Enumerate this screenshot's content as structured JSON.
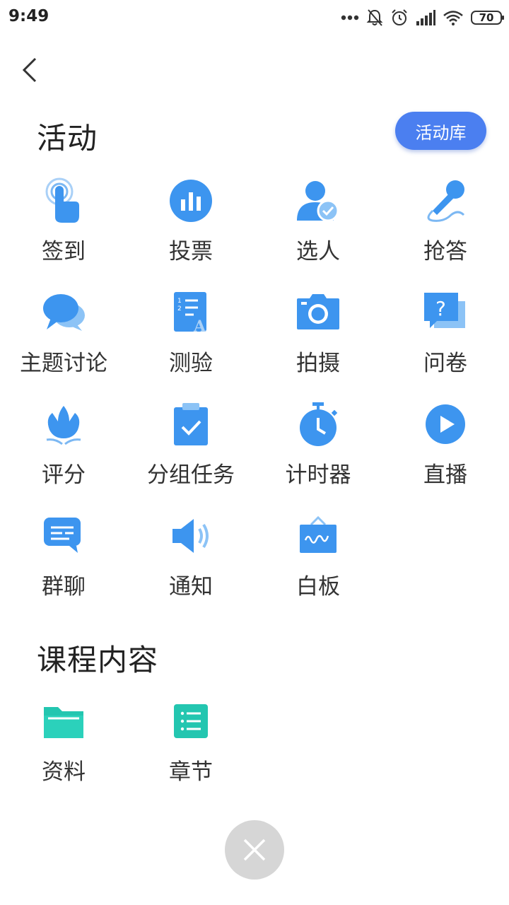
{
  "status_bar": {
    "time": "9:49",
    "battery": "70"
  },
  "activities": {
    "title": "活动",
    "library_button": "活动库",
    "items": [
      {
        "label": "签到",
        "icon": "tap-hand-icon"
      },
      {
        "label": "投票",
        "icon": "bar-chart-icon"
      },
      {
        "label": "选人",
        "icon": "person-check-icon"
      },
      {
        "label": "抢答",
        "icon": "microphone-icon"
      },
      {
        "label": "主题讨论",
        "icon": "chat-bubbles-icon"
      },
      {
        "label": "测验",
        "icon": "quiz-sheet-icon"
      },
      {
        "label": "拍摄",
        "icon": "camera-icon"
      },
      {
        "label": "问卷",
        "icon": "question-board-icon"
      },
      {
        "label": "评分",
        "icon": "tulip-icon"
      },
      {
        "label": "分组任务",
        "icon": "clipboard-check-icon"
      },
      {
        "label": "计时器",
        "icon": "stopwatch-icon"
      },
      {
        "label": "直播",
        "icon": "play-circle-icon"
      },
      {
        "label": "群聊",
        "icon": "message-icon"
      },
      {
        "label": "通知",
        "icon": "speaker-icon"
      },
      {
        "label": "白板",
        "icon": "whiteboard-icon"
      }
    ]
  },
  "course_content": {
    "title": "课程内容",
    "items": [
      {
        "label": "资料",
        "icon": "folder-icon"
      },
      {
        "label": "章节",
        "icon": "chapter-list-icon"
      }
    ]
  },
  "colors": {
    "accent": "#4b7ff0",
    "icon_blue": "#3d95ef",
    "icon_teal": "#23c6b0",
    "fab": "#d6d6d6"
  }
}
